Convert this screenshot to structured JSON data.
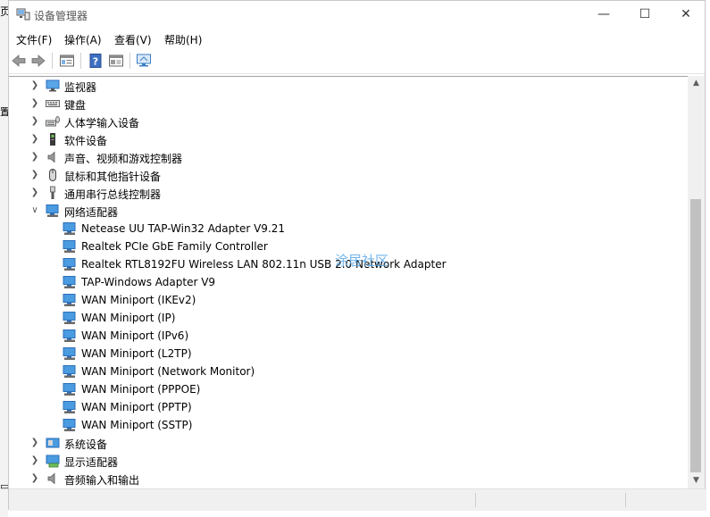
{
  "background": {
    "left_char_1": "页",
    "left_char_2": "置",
    "left_char_3": "▭"
  },
  "window": {
    "title": "设备管理器",
    "controls": {
      "minimize": "—",
      "maximize": "☐",
      "close": "✕"
    }
  },
  "menu": [
    {
      "label": "文件(F)"
    },
    {
      "label": "操作(A)"
    },
    {
      "label": "查看(V)"
    },
    {
      "label": "帮助(H)"
    }
  ],
  "toolbar": {
    "icons": [
      "back-arrow-icon",
      "forward-arrow-icon",
      "properties-icon",
      "help-icon",
      "update-driver-icon",
      "monitor-icon"
    ]
  },
  "tree": {
    "categories_top": [
      {
        "label": "监视器",
        "icon": "monitor-icon"
      },
      {
        "label": "键盘",
        "icon": "keyboard-icon"
      },
      {
        "label": "人体学输入设备",
        "icon": "hid-icon"
      },
      {
        "label": "软件设备",
        "icon": "software-device-icon"
      },
      {
        "label": "声音、视频和游戏控制器",
        "icon": "speaker-icon"
      },
      {
        "label": "鼠标和其他指针设备",
        "icon": "mouse-icon"
      },
      {
        "label": "通用串行总线控制器",
        "icon": "usb-icon"
      }
    ],
    "network": {
      "label": "网络适配器",
      "children": [
        "Netease UU TAP-Win32 Adapter V9.21",
        "Realtek PCIe GbE Family Controller",
        "Realtek RTL8192FU Wireless LAN 802.11n USB 2.0 Network Adapter",
        "TAP-Windows Adapter V9",
        "WAN Miniport (IKEv2)",
        "WAN Miniport (IP)",
        "WAN Miniport (IPv6)",
        "WAN Miniport (L2TP)",
        "WAN Miniport (Network Monitor)",
        "WAN Miniport (PPPOE)",
        "WAN Miniport (PPTP)",
        "WAN Miniport (SSTP)"
      ]
    },
    "categories_bottom": [
      {
        "label": "系统设备",
        "icon": "system-device-icon"
      },
      {
        "label": "显示适配器",
        "icon": "display-adapter-icon"
      },
      {
        "label": "音频输入和输出",
        "icon": "audio-io-icon"
      }
    ]
  },
  "watermark": "涂居社区",
  "colors": {
    "accent": "#2b7bd6",
    "scroll_thumb": "#c1c1c1"
  }
}
